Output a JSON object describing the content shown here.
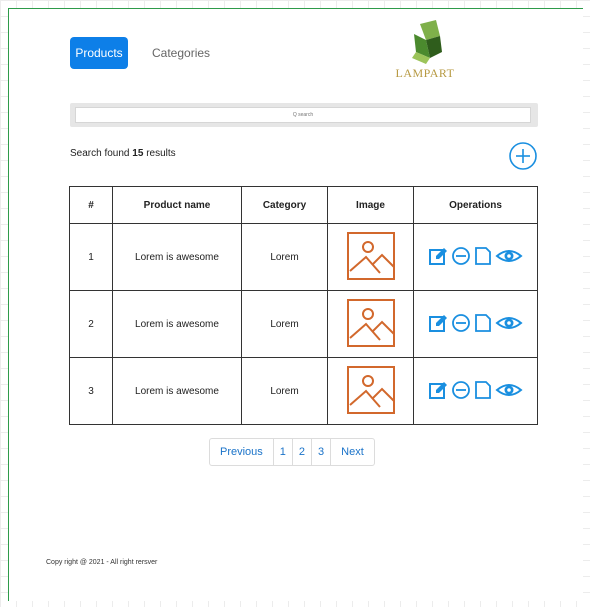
{
  "tabs": {
    "products": "Products",
    "categories": "Categories"
  },
  "logo": {
    "text": "LAMPART",
    "colors": {
      "green": "#4b8a2e",
      "dark": "#2f5d1c",
      "text": "#b79a43"
    }
  },
  "search": {
    "placeholder": "Q search"
  },
  "results": {
    "prefix": "Search found",
    "count": "15",
    "suffix": "results"
  },
  "add_button": {
    "icon": "plus-circle-icon"
  },
  "table": {
    "headers": [
      "#",
      "Product name",
      "Category",
      "Image",
      "Operations"
    ],
    "rows": [
      {
        "num": "1",
        "name": "Lorem is awesome",
        "category": "Lorem"
      },
      {
        "num": "2",
        "name": "Lorem is awesome",
        "category": "Lorem"
      },
      {
        "num": "3",
        "name": "Lorem is awesome",
        "category": "Lorem"
      }
    ],
    "image_icon": "image-placeholder-icon",
    "operation_icons": [
      "edit-icon",
      "minus-circle-icon",
      "document-icon",
      "eye-icon"
    ]
  },
  "pagination": {
    "previous": "Previous",
    "pages": [
      "1",
      "2",
      "3"
    ],
    "next": "Next"
  },
  "footer": {
    "copyright": "Copy right @ 2021 - All right rersver"
  },
  "colors": {
    "primary": "#0d7fe8",
    "icon_blue": "#1a8fe0",
    "image_orange": "#d2682c",
    "frame_green": "#2e9b4a"
  }
}
